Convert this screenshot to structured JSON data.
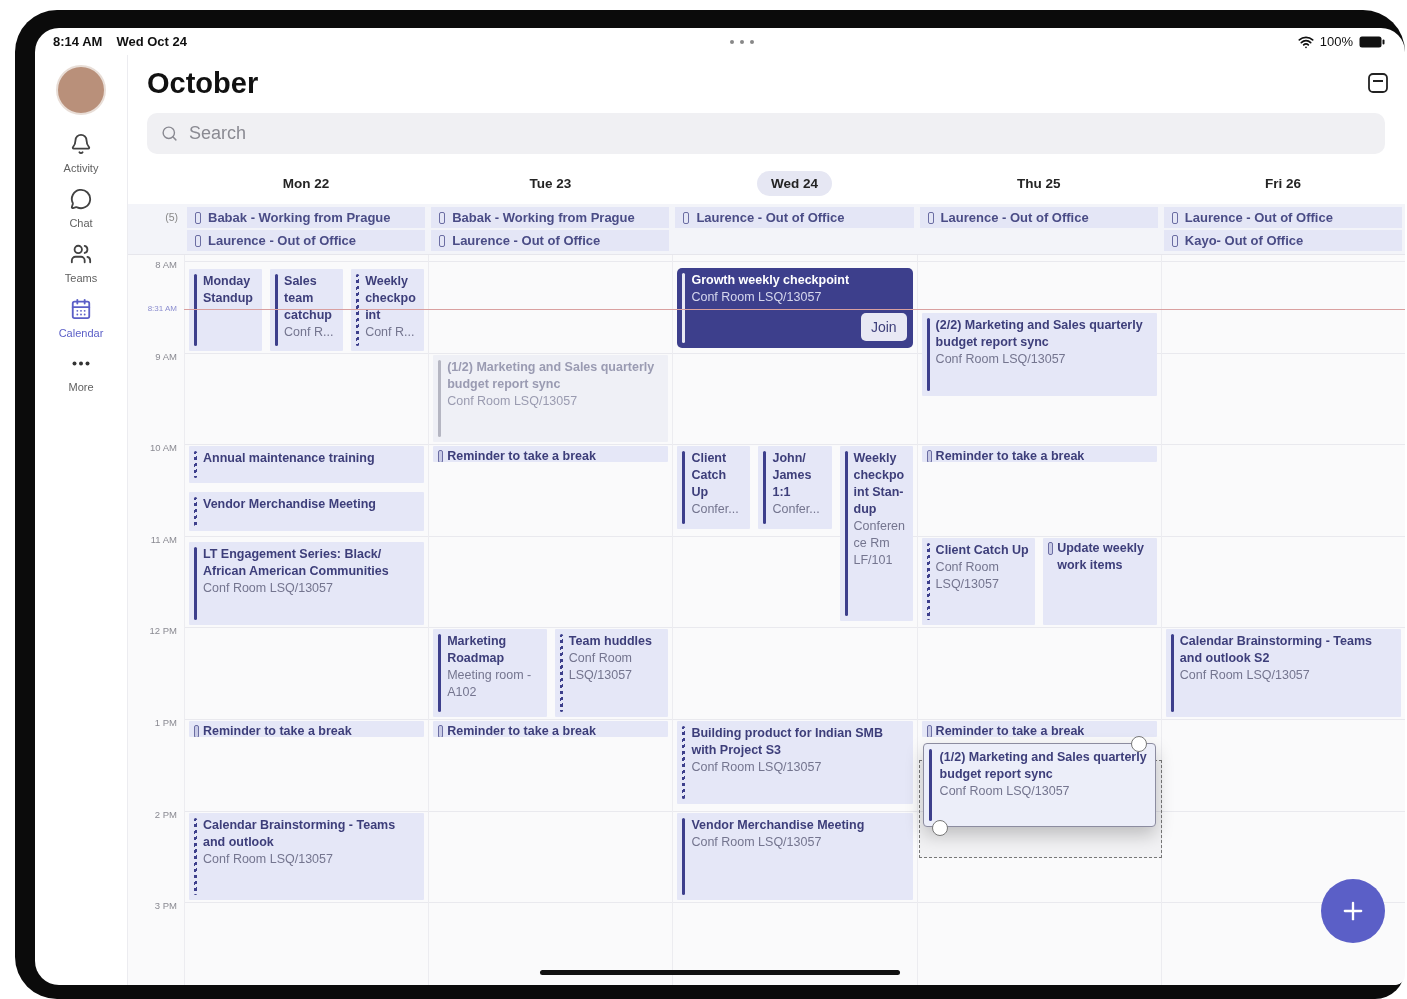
{
  "status_bar": {
    "time": "8:14 AM",
    "date": "Wed Oct 24",
    "battery": "100%"
  },
  "sidebar": {
    "items": [
      {
        "kind": "activity",
        "label": "Activity",
        "selected": false
      },
      {
        "kind": "chat",
        "label": "Chat",
        "selected": false
      },
      {
        "kind": "teams",
        "label": "Teams",
        "selected": false
      },
      {
        "kind": "calendar",
        "label": "Calendar",
        "selected": true
      },
      {
        "kind": "more",
        "label": "More",
        "selected": false
      }
    ]
  },
  "header": {
    "title": "October"
  },
  "search": {
    "placeholder": "Search"
  },
  "all_day_count": "(5)",
  "time_labels": [
    "8 AM",
    "9 AM",
    "10 AM",
    "11 AM",
    "12 PM",
    "1 PM",
    "2 PM",
    "3 PM"
  ],
  "now": {
    "label": "8:31 AM"
  },
  "days": [
    {
      "label": "Mon 22",
      "selected": false,
      "all_day": [
        "Babak - Working from Prague",
        "Laurence - Out of Office"
      ],
      "events": [
        {
          "kind": "busy",
          "title": "Monday Standup"
        },
        {
          "kind": "busy",
          "title": "Sales team catchup",
          "location": "Conf R..."
        },
        {
          "kind": "tentative",
          "title": "Weekly checkpoint",
          "location": "Conf R..."
        },
        {
          "kind": "tentative",
          "title": "Annual maintenance training"
        },
        {
          "kind": "tentative",
          "title": "Vendor Merchandise Meeting"
        },
        {
          "kind": "busy",
          "title": "LT Engagement Series: Black/ African American Communities",
          "location": "Conf Room LSQ/13057"
        },
        {
          "kind": "reminder",
          "title": "Reminder to take a break"
        },
        {
          "kind": "tentative",
          "title": "Calendar Brainstorming - Teams and outlook",
          "location": "Conf Room LSQ/13057"
        }
      ]
    },
    {
      "label": "Tue 23",
      "selected": false,
      "all_day": [
        "Babak - Working from Prague",
        "Laurence - Out of Office"
      ],
      "events": [
        {
          "kind": "moving",
          "title": "(1/2) Marketing and Sales quarterly budget report sync",
          "location": "Conf Room LSQ/13057"
        },
        {
          "kind": "reminder",
          "title": "Reminder to take a break"
        },
        {
          "kind": "busy",
          "title": "Marketing Roadmap",
          "location": "Meeting room - A102"
        },
        {
          "kind": "tentative",
          "title": "Team huddles",
          "location": "Conf Room LSQ/13057"
        },
        {
          "kind": "reminder",
          "title": "Reminder to take a break"
        }
      ]
    },
    {
      "label": "Wed 24",
      "selected": true,
      "all_day": [
        "Laurence - Out of Office"
      ],
      "events": [
        {
          "kind": "live",
          "title": "Growth weekly checkpoint",
          "location": "Conf Room LSQ/13057",
          "action": "Join"
        },
        {
          "kind": "busy",
          "title": "Client Catch Up",
          "location": "Confer..."
        },
        {
          "kind": "busy",
          "title": "John/ James 1:1",
          "location": "Confer..."
        },
        {
          "kind": "busy",
          "title": "Weekly checkpoint Stan-dup",
          "location": "Conference Rm LF/101"
        },
        {
          "kind": "tentative",
          "title": "Building product for Indian SMB with Project S3",
          "location": "Conf Room LSQ/13057"
        },
        {
          "kind": "busy",
          "title": "Vendor Merchandise Meeting",
          "location": "Conf Room LSQ/13057"
        }
      ]
    },
    {
      "label": "Thu 25",
      "selected": false,
      "all_day": [
        "Laurence - Out of Office"
      ],
      "events": [
        {
          "kind": "busy",
          "title": "(2/2) Marketing and Sales quarterly budget report sync",
          "location": "Conf Room LSQ/13057"
        },
        {
          "kind": "reminder",
          "title": "Reminder to take a break"
        },
        {
          "kind": "tentative",
          "title": "Client Catch Up",
          "location": "Conf Room LSQ/13057"
        },
        {
          "kind": "reminder",
          "title": "Update weekly work items"
        },
        {
          "kind": "reminder",
          "title": "Reminder to take a break"
        }
      ],
      "dragged": {
        "title": "(1/2) Marketing and Sales quarterly budget report sync",
        "location": "Conf Room LSQ/13057"
      }
    },
    {
      "label": "Fri 26",
      "selected": false,
      "all_day": [
        "Laurence - Out of Office",
        "Kayo- Out of Office"
      ],
      "events": [
        {
          "kind": "busy",
          "title": "Calendar Brainstorming - Teams and outlook S2",
          "location": "Conf Room LSQ/13057"
        }
      ]
    }
  ]
}
